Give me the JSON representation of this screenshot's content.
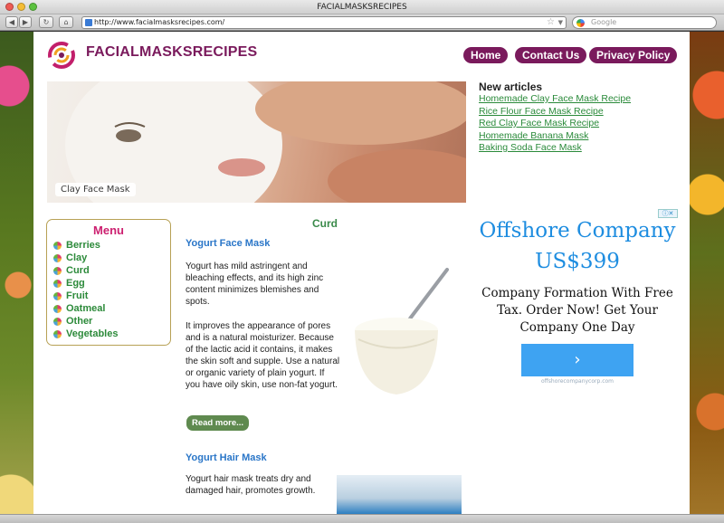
{
  "browser": {
    "title": "FACIALMASKSRECIPES",
    "url": "http://www.facialmasksrecipes.com/",
    "search_placeholder": "Google"
  },
  "site": {
    "name": "FACIALMASKSRECIPES",
    "nav": [
      "Home",
      "Contact Us",
      "Privacy Policy"
    ]
  },
  "hero": {
    "caption": "Clay Face Mask"
  },
  "new_articles": {
    "heading": "New articles",
    "items": [
      "Homemade Clay Face Mask Recipe",
      "Rice Flour Face Mask Recipe",
      "Red Clay Face Mask Recipe",
      "Homemade Banana Mask",
      "Baking Soda Face Mask"
    ]
  },
  "menu": {
    "title": "Menu",
    "items": [
      "Berries",
      "Clay",
      "Curd",
      "Egg",
      "Fruit",
      "Oatmeal",
      "Other",
      "Vegetables"
    ]
  },
  "content": {
    "section_title": "Curd",
    "article1": {
      "title": "Yogurt Face Mask",
      "para1": "Yogurt has mild astringent and bleaching effects, and its high zinc content minimizes blemishes and spots.",
      "para2": "It improves the appearance of pores and is a natural moisturizer. Because of the lactic acid it contains, it makes the skin soft and supple. Use a natural or organic variety of plain yogurt. If you have oily skin, use non-fat yogurt.",
      "read_more": "Read more..."
    },
    "article2": {
      "title": "Yogurt Hair Mask",
      "para1": "Yogurt hair mask treats dry and damaged hair, promotes growth."
    }
  },
  "ad": {
    "headline": "Offshore Company US$399",
    "body": "Company Formation With Free Tax. Order Now! Get Your Company One Day",
    "button": "›",
    "url": "offshorecompanycorp.com"
  }
}
